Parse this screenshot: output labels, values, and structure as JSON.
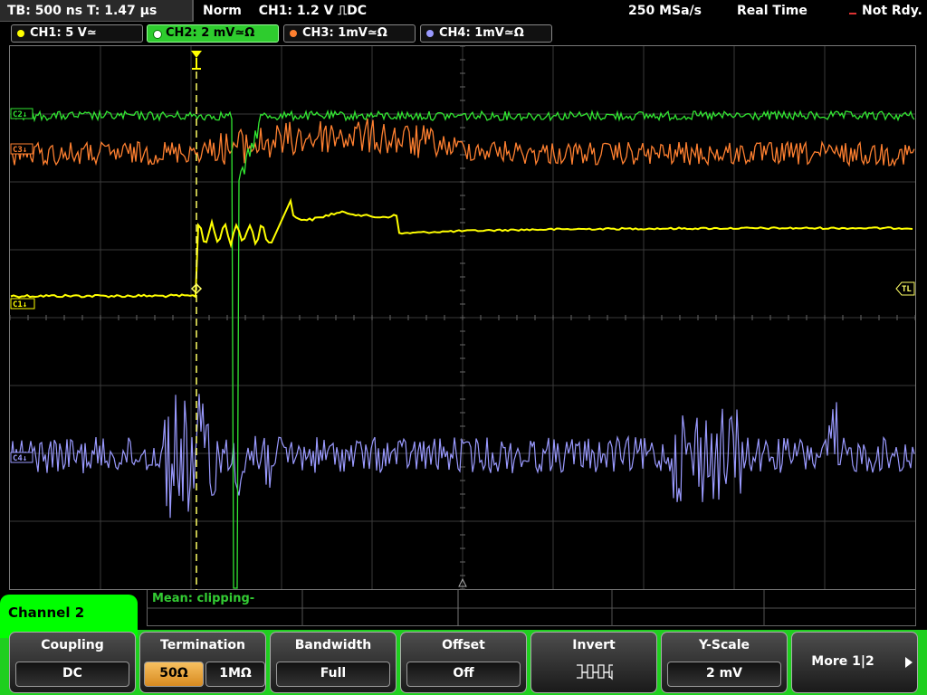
{
  "topbar": {
    "timebase": "TB: 500 ns   T: 1.47 µs",
    "trigger_mode": "Norm",
    "trigger_info": "CH1: 1.2 V ⎍DC",
    "sample_rate": "250 MSa/s",
    "acq_mode": "Real Time",
    "status": "Not Rdy."
  },
  "channels": [
    {
      "label": "CH1: 5 V≃",
      "color": "#ffff00",
      "active": false
    },
    {
      "label": "CH2: 2 mV≃Ω",
      "color": "#32e632",
      "active": true
    },
    {
      "label": "CH3: 1mV≃Ω",
      "color": "#ff8030",
      "active": false
    },
    {
      "label": "CH4: 1mV≃Ω",
      "color": "#9a9aff",
      "active": false
    }
  ],
  "markers": {
    "c2": "C2↓",
    "c3": "C3↓",
    "c1": "C1↓",
    "c4": "C4↓",
    "tl": "TL"
  },
  "measurement": {
    "text": "Mean: clipping-"
  },
  "menu": {
    "title": "Channel 2",
    "softkeys": {
      "coupling": {
        "title": "Coupling",
        "value": "DC"
      },
      "termination": {
        "title": "Termination",
        "options": [
          "50Ω",
          "1MΩ"
        ],
        "selected": "50Ω"
      },
      "bandwidth": {
        "title": "Bandwidth",
        "value": "Full"
      },
      "offset": {
        "title": "Offset",
        "value": "Off"
      },
      "invert": {
        "title": "Invert",
        "icon": "invert-waveform-icon"
      },
      "yscale": {
        "title": "Y-Scale",
        "value": "2 mV"
      },
      "more": {
        "label": "More 1|2"
      }
    }
  },
  "colors": {
    "ch1": "#ffff00",
    "ch2": "#32e632",
    "ch3": "#ff8030",
    "ch4": "#9a9aff",
    "menu_green": "#1fcf1f",
    "selected_option": "#e6a038"
  }
}
